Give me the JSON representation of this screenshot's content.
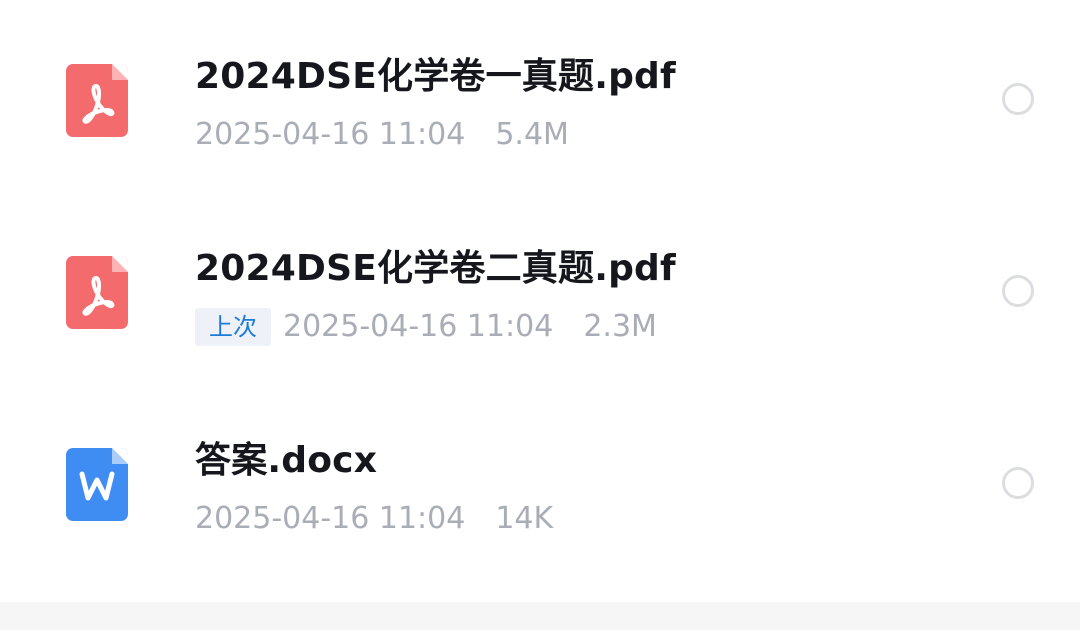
{
  "files": [
    {
      "name": "2024DSE化学卷一真题.pdf",
      "time": "2025-04-16 11:04",
      "size": "5.4M",
      "icon": "pdf-file-icon",
      "icon_color": "#f46b6e",
      "badge": null
    },
    {
      "name": "2024DSE化学卷二真题.pdf",
      "time": "2025-04-16 11:04",
      "size": "2.3M",
      "icon": "pdf-file-icon",
      "icon_color": "#f46b6e",
      "badge": "上次"
    },
    {
      "name": "答案.docx",
      "time": "2025-04-16 11:04",
      "size": "14K",
      "icon": "word-file-icon",
      "icon_color": "#3f8cf3",
      "badge": null
    }
  ],
  "colors": {
    "title": "#15171c",
    "meta": "#a9adb6",
    "badge_text": "#1d7bd8",
    "badge_bg": "#eef2f8",
    "radio_border": "#dcdde1"
  }
}
